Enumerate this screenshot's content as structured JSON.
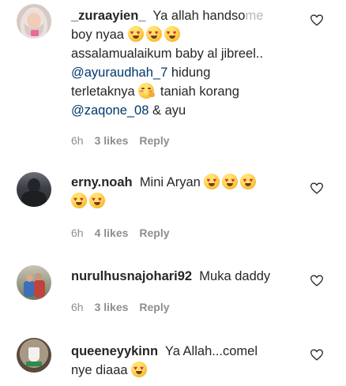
{
  "comments": [
    {
      "username": "_zuraayien_",
      "text_a": "Ya allah handso",
      "text_a_fade": "me",
      "text_b": "boy nyaa",
      "text_c": "assalamualaikum baby al jibreel..",
      "mention1": "@ayuraudhah_7",
      "text_d": " hidung",
      "text_e": "terletaknya",
      "text_f": " taniah korang",
      "mention2": "@zaqone_08",
      "text_g": " & ayu",
      "time": "6h",
      "likes": "3 likes",
      "reply": "Reply"
    },
    {
      "username": "erny.noah",
      "text_a": "Mini Aryan",
      "time": "6h",
      "likes": "4 likes",
      "reply": "Reply"
    },
    {
      "username": "nurulhusnajohari92",
      "text_a": "Muka daddy",
      "time": "6h",
      "likes": "3 likes",
      "reply": "Reply"
    },
    {
      "username": "queeneyykinn",
      "text_a": "Ya Allah...comel",
      "text_b": "nye diaaa",
      "time": "",
      "likes": "",
      "reply": ""
    }
  ],
  "icons": {
    "heart": "heart-outline-icon",
    "emoji_love": "smiling-face-with-heart-eyes",
    "emoji_hug": "hugging-face"
  }
}
